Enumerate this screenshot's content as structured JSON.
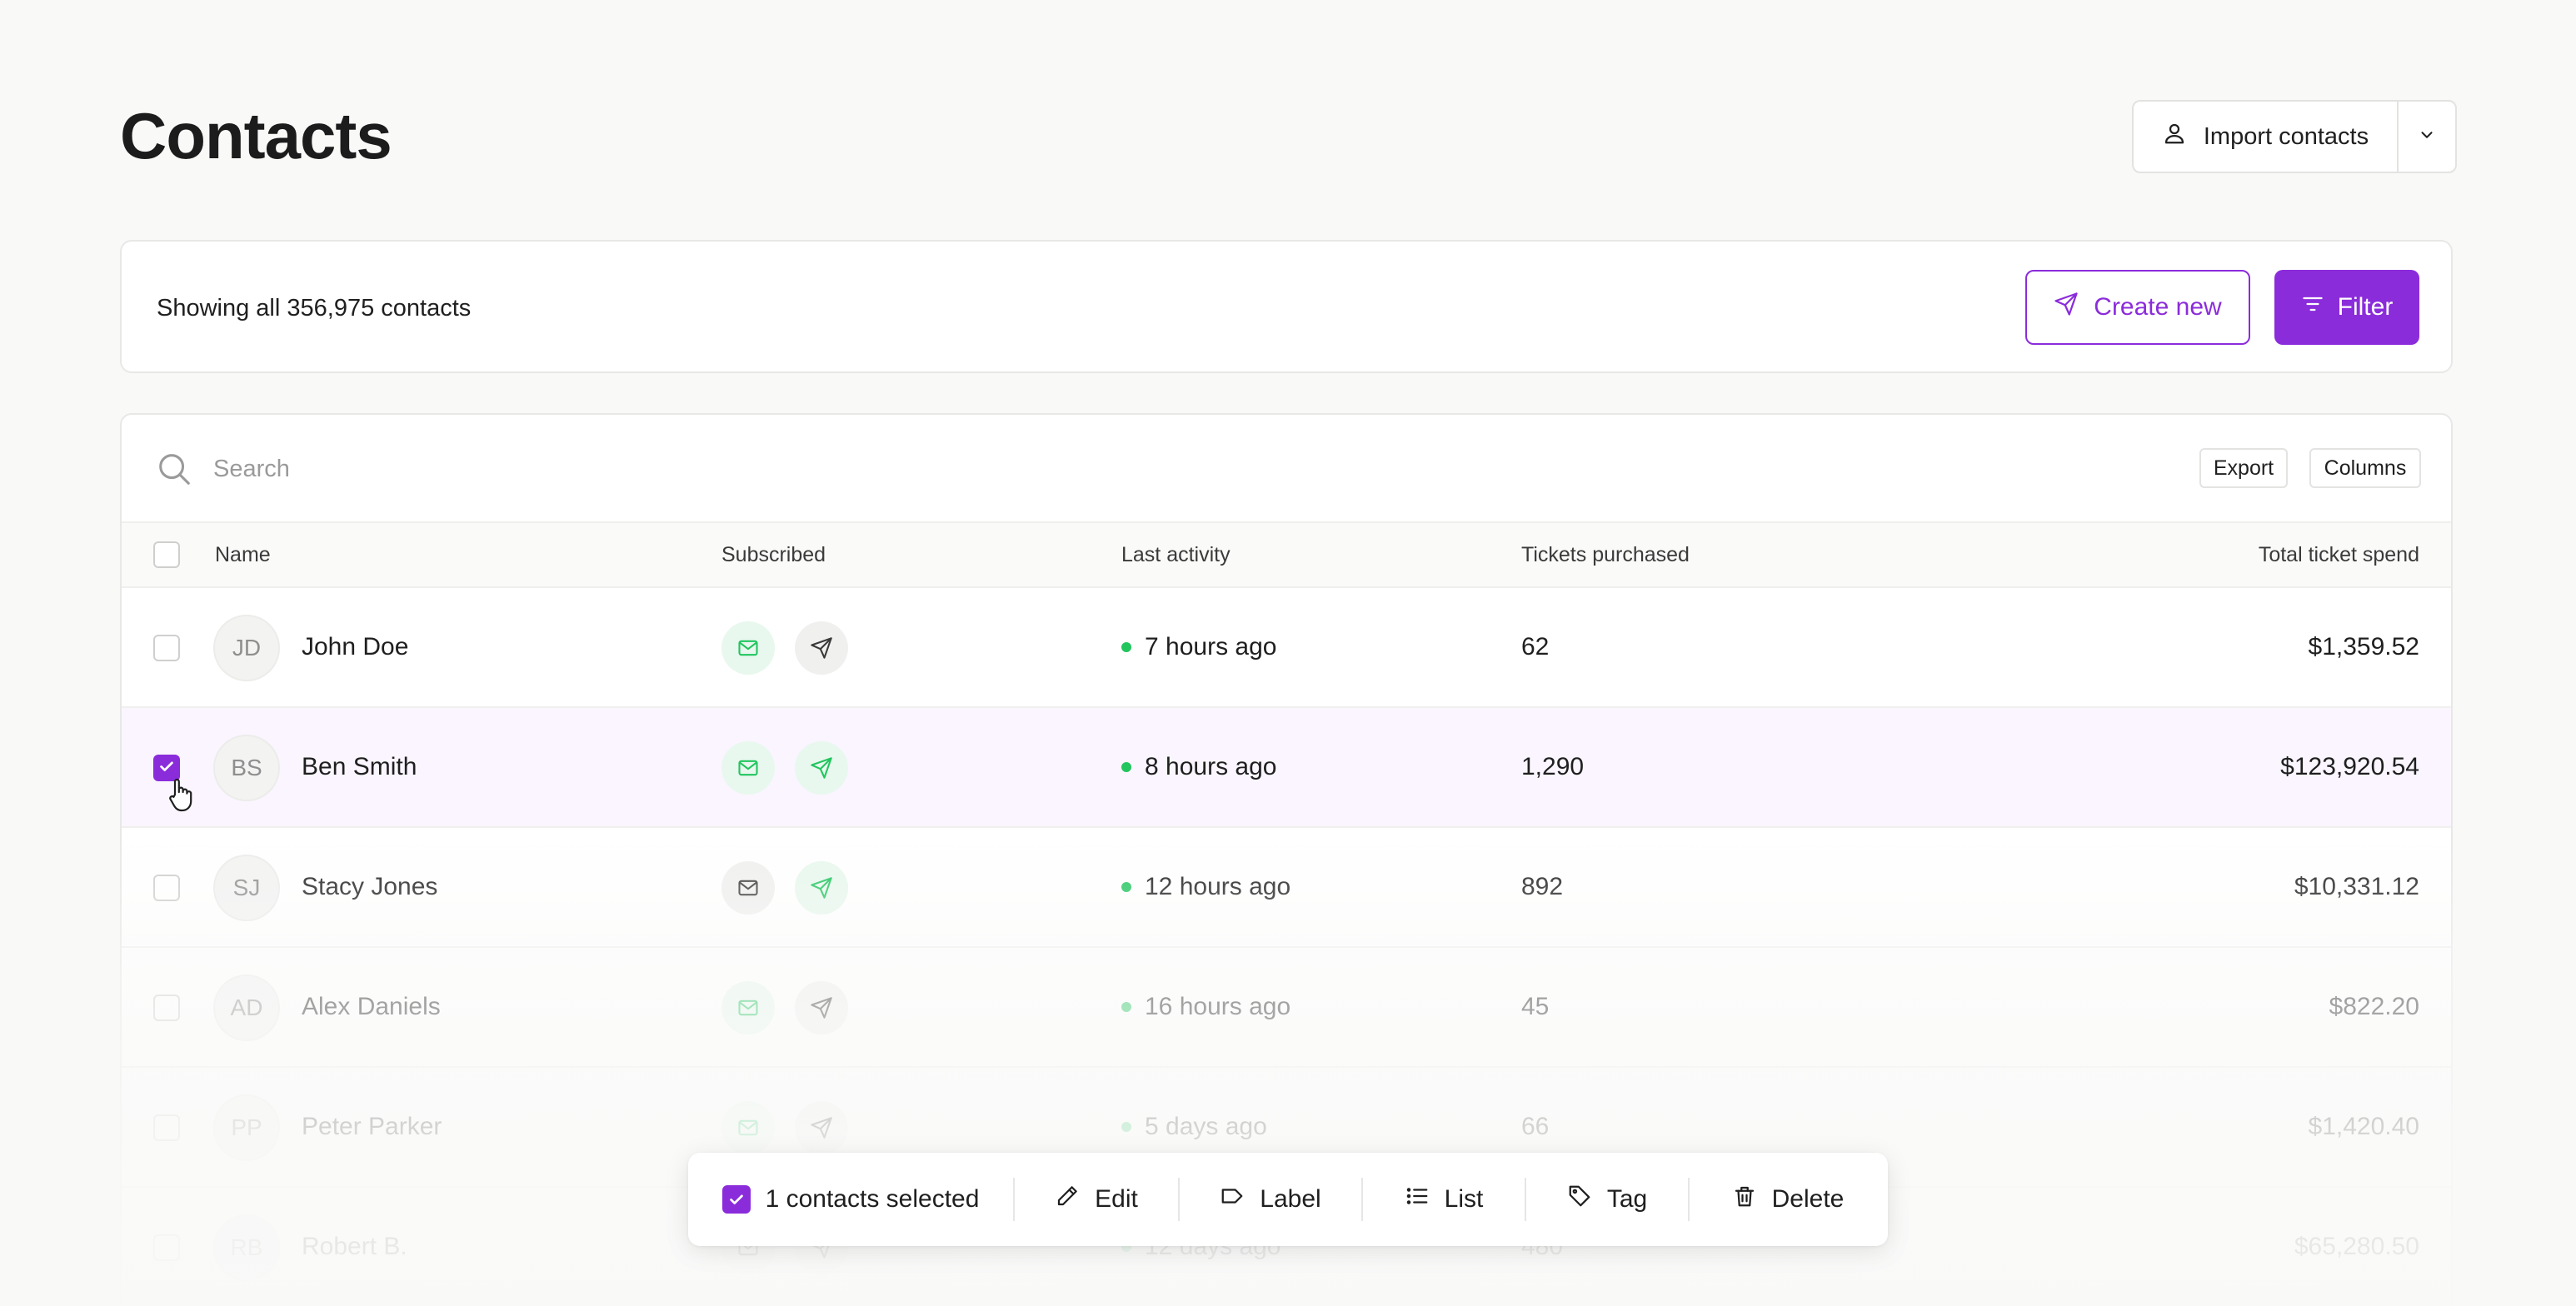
{
  "header": {
    "title": "Contacts",
    "import_label": "Import contacts"
  },
  "summary": {
    "text": "Showing all 356,975 contacts",
    "create_label": "Create new",
    "filter_label": "Filter"
  },
  "table": {
    "search_placeholder": "Search",
    "export_label": "Export",
    "columns_label": "Columns",
    "headers": {
      "name": "Name",
      "subscribed": "Subscribed",
      "last_activity": "Last activity",
      "tickets": "Tickets purchased",
      "spend": "Total ticket spend"
    },
    "rows": [
      {
        "initials": "JD",
        "name": "John Doe",
        "email_subscribed": true,
        "sms_subscribed": false,
        "last_activity": "7 hours ago",
        "tickets": "62",
        "spend": "$1,359.52",
        "selected": false
      },
      {
        "initials": "BS",
        "name": "Ben Smith",
        "email_subscribed": true,
        "sms_subscribed": true,
        "last_activity": "8 hours ago",
        "tickets": "1,290",
        "spend": "$123,920.54",
        "selected": true
      },
      {
        "initials": "SJ",
        "name": "Stacy Jones",
        "email_subscribed": false,
        "sms_subscribed": true,
        "last_activity": "12 hours ago",
        "tickets": "892",
        "spend": "$10,331.12",
        "selected": false
      },
      {
        "initials": "AD",
        "name": "Alex Daniels",
        "email_subscribed": true,
        "sms_subscribed": false,
        "last_activity": "16 hours ago",
        "tickets": "45",
        "spend": "$822.20",
        "selected": false
      },
      {
        "initials": "PP",
        "name": "Peter Parker",
        "email_subscribed": true,
        "sms_subscribed": false,
        "last_activity": "5 days ago",
        "tickets": "66",
        "spend": "$1,420.40",
        "selected": false
      },
      {
        "initials": "RB",
        "name": "Robert B.",
        "email_subscribed": false,
        "sms_subscribed": false,
        "last_activity": "12 days ago",
        "tickets": "480",
        "spend": "$65,280.50",
        "selected": false
      }
    ]
  },
  "action_bar": {
    "selected_text": "1 contacts selected",
    "edit_label": "Edit",
    "label_label": "Label",
    "list_label": "List",
    "tag_label": "Tag",
    "delete_label": "Delete"
  },
  "colors": {
    "accent": "#8b2cdb",
    "success": "#22c55e",
    "selected_row": "#faf5fe"
  }
}
